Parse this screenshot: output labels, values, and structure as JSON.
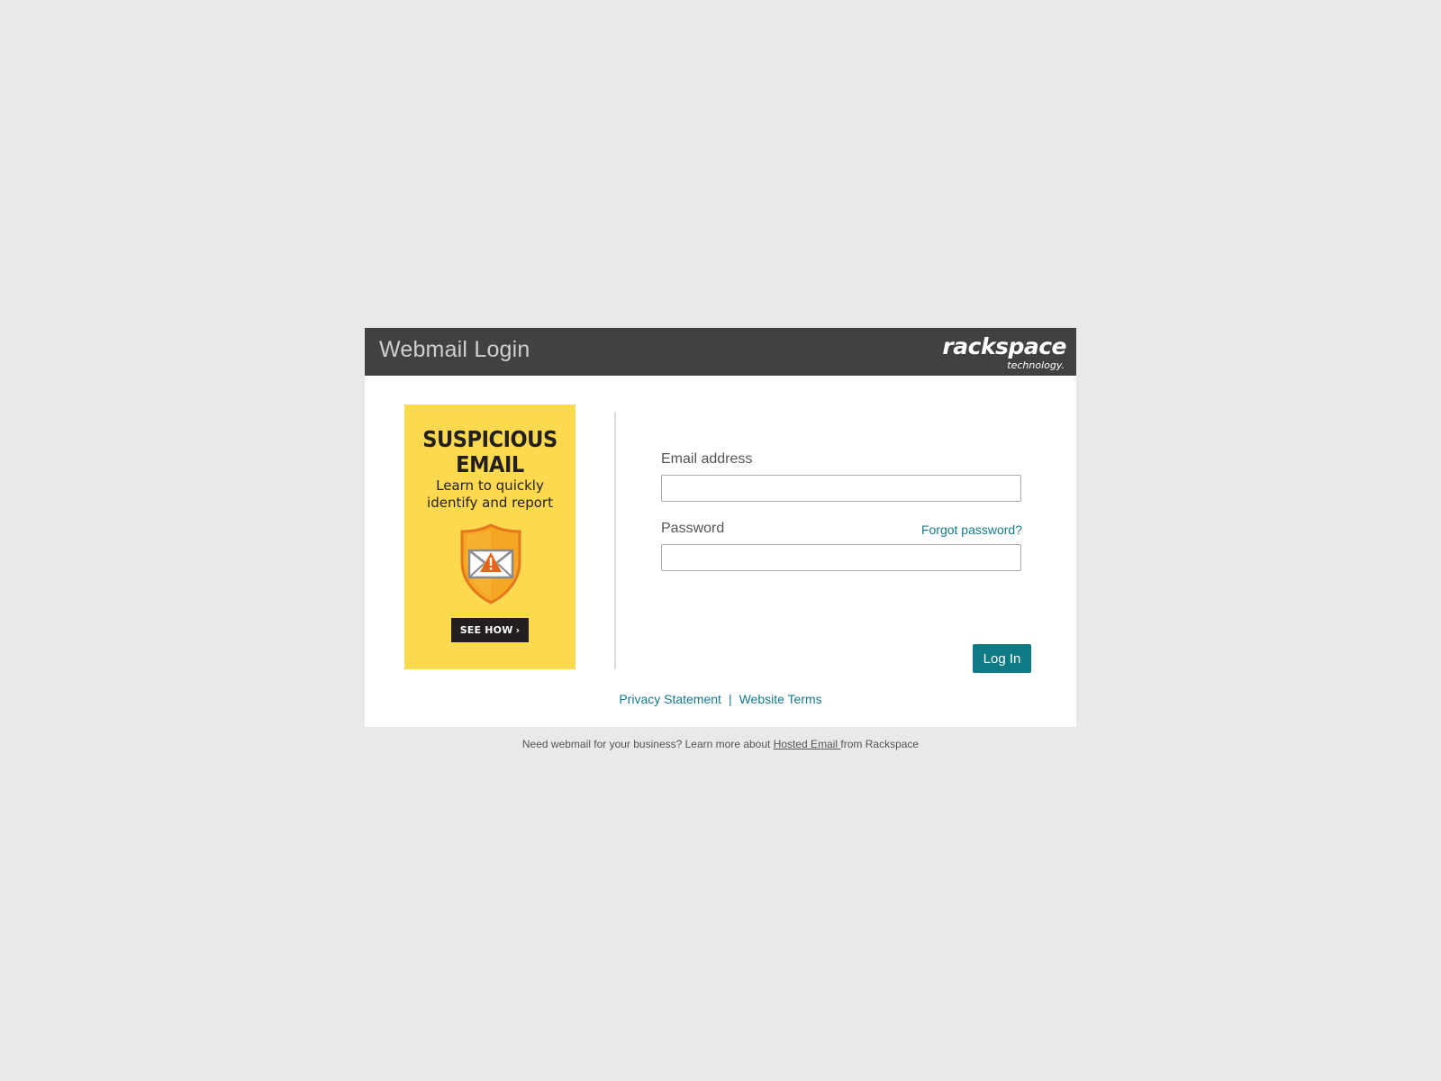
{
  "header": {
    "title": "Webmail Login",
    "logo_main": "rackspace",
    "logo_sub": "technology.",
    "background": "#414141"
  },
  "ad": {
    "headline_line1": "SUSPICIOUS",
    "headline_line2": "EMAIL",
    "sub_line1": "Learn to quickly",
    "sub_line2": "identify and report",
    "button_label": "SEE HOW",
    "button_chevron": "›",
    "icon": "shield-envelope-warning-icon",
    "background": "#fdd94f"
  },
  "form": {
    "email_label": "Email address",
    "email_value": "",
    "password_label": "Password",
    "password_value": "",
    "forgot_label": "Forgot password?",
    "login_label": "Log In",
    "accent": "#0f7a84"
  },
  "links": {
    "privacy": "Privacy Statement",
    "separator": "|",
    "terms": "Website Terms"
  },
  "footer": {
    "text_before": "Need webmail for your business? Learn more about ",
    "link": "Hosted Email ",
    "text_after": "from Rackspace"
  }
}
